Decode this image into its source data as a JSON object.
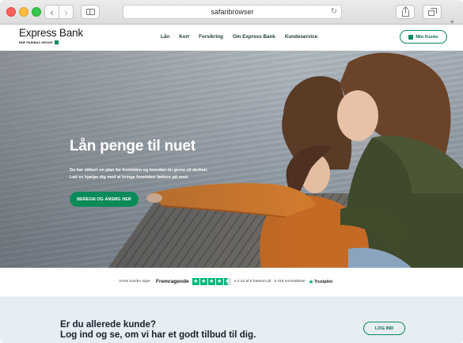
{
  "browser": {
    "url": "safaribrowser",
    "back_icon": "chevron-left-icon",
    "forward_icon": "chevron-right-icon",
    "reload_icon": "reload-icon"
  },
  "site": {
    "logo_name": "Express Bank",
    "logo_sub": "BNP PARIBAS GROUP",
    "nav": [
      "Lån",
      "Kort",
      "Forsikring",
      "Om Express Bank",
      "Kundeservice"
    ],
    "account_label": "Min Konto"
  },
  "hero": {
    "title": "Lån penge til nuet",
    "text_line1": "Du har sikkert en plan for fremtiden og hvordan du gerne vil derhen.",
    "text_line2": "Lad os hjælpe dig med at bringe fremtiden lættere på nuet.",
    "cta_label": "BEREGN OG ANSØG HER"
  },
  "trust": {
    "prefix": "Vores kunder siger",
    "rating_word": "Fremragende",
    "score_text": "4.4 ud af 5 baseret på",
    "review_count": "3.419 anmeldelser",
    "brand": "Trustpilot",
    "stars": 4.5
  },
  "customer": {
    "title_line1": "Er du allerede kunde?",
    "title_line2": "Log ind og se, om vi har et godt tilbud til dig.",
    "login_label": "LOG IND"
  },
  "colors": {
    "brand_green": "#0b8a5a",
    "trustpilot_green": "#00b67a",
    "customer_bg": "#e6edf3"
  }
}
